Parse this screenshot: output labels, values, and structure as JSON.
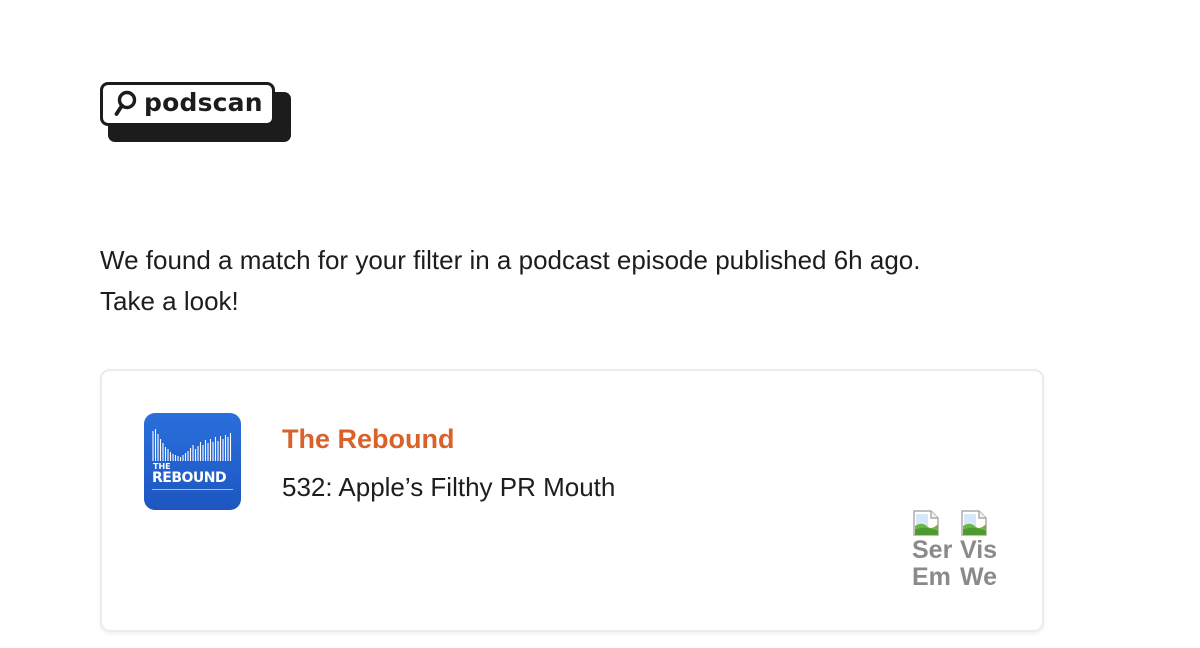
{
  "logo": {
    "text": "podscan",
    "icon": "search-icon"
  },
  "message": {
    "line1": "We found a match for your filter in a podcast episode published 6h ago.",
    "line2": "Take a look!"
  },
  "card": {
    "cover": {
      "the": "THE",
      "name": "REBOUND",
      "colors": {
        "background": "#1d56c0",
        "text": "#ffffff"
      }
    },
    "show_name": "The Rebound",
    "episode_title": "532: Apple’s Filthy PR Mouth",
    "actions": [
      {
        "alt_line1": "Ser",
        "alt_line2": "Em",
        "icon": "broken-image-icon"
      },
      {
        "alt_line1": "Vis",
        "alt_line2": "We",
        "icon": "broken-image-icon"
      }
    ]
  },
  "colors": {
    "accent": "#d9622b",
    "text": "#1d1d1f",
    "muted": "#8a8a8a",
    "card_border": "#ececec"
  }
}
